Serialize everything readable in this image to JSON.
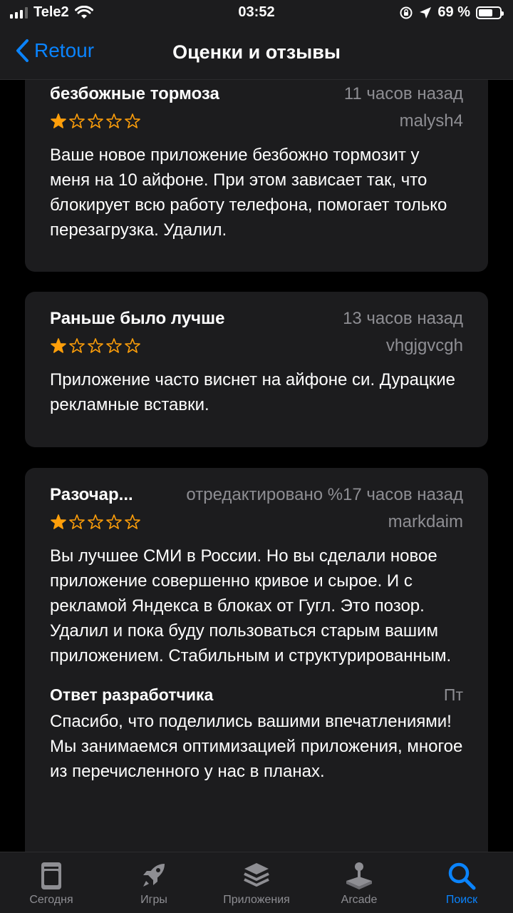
{
  "status": {
    "carrier": "Tele2",
    "time": "03:52",
    "battery": "69 %",
    "battery_level": 0.69
  },
  "nav": {
    "back_label": "Retour",
    "title": "Оценки и отзывы"
  },
  "reviews": [
    {
      "title": "безбожные тормоза",
      "date": "11 часов назад",
      "author": "malysh4",
      "rating": 1,
      "body": "Ваше новое приложение безбожно тормозит у меня на 10 айфоне. При этом зависает так, что блокирует всю работу телефона, помогает только перезагрузка. Удалил."
    },
    {
      "title": "Раньше было лучше",
      "date": "13 часов назад",
      "author": "vhgjgvcgh",
      "rating": 1,
      "body": "Приложение часто виснет на айфоне си. Дурацкие рекламные вставки."
    },
    {
      "title": "Разочар...",
      "date": "отредактировано %17 часов назад",
      "author": "markdaim",
      "rating": 1,
      "body": "Вы лучшее СМИ в России. Но вы сделали новое приложение совершенно кривое и сырое. И с рекламой Яндекса в блоках от Гугл. Это позор. Удалил и пока буду пользоваться старым вашим приложением. Стабильным и структурированным.",
      "dev_reply": {
        "label": "Ответ разработчика",
        "date": "Пт",
        "body": "Спасибо, что поделились вашими впечатлениями! Мы занимаемся оптимизацией приложения, многое из перечисленного у нас в планах."
      }
    }
  ],
  "tabs": [
    {
      "label": "Сегодня",
      "icon": "today-icon"
    },
    {
      "label": "Игры",
      "icon": "rocket-icon"
    },
    {
      "label": "Приложения",
      "icon": "apps-stack-icon"
    },
    {
      "label": "Arcade",
      "icon": "joystick-icon"
    },
    {
      "label": "Поиск",
      "icon": "search-icon",
      "active": true
    }
  ],
  "colors": {
    "accent": "#0a84ff",
    "star": "#ff9f0a",
    "card": "#1c1c1e",
    "secondary_text": "#8e8e93"
  }
}
